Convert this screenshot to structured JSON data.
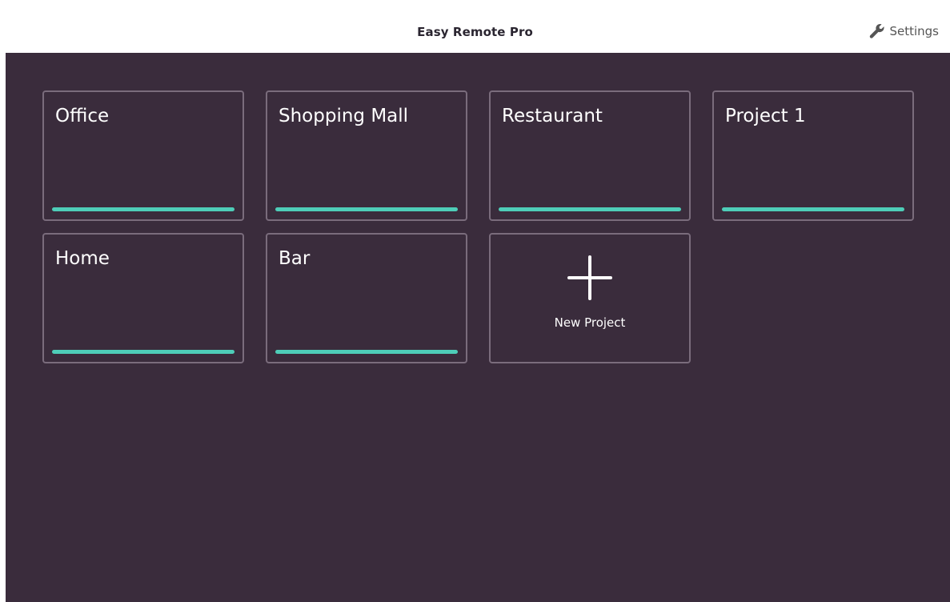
{
  "app": {
    "title": "Easy Remote Pro",
    "settings_label": "Settings",
    "settings_icon": "wrench-icon"
  },
  "projects": [
    {
      "name": "Office"
    },
    {
      "name": "Shopping Mall"
    },
    {
      "name": "Restaurant"
    },
    {
      "name": "Project 1"
    },
    {
      "name": "Home"
    },
    {
      "name": "Bar"
    }
  ],
  "new_project": {
    "label": "New Project",
    "icon": "plus-icon"
  },
  "colors": {
    "background": "#3a2c3c",
    "card_border": "#7a6c7c",
    "accent_bar": "#4ecdb8",
    "header": "#ffffff"
  }
}
